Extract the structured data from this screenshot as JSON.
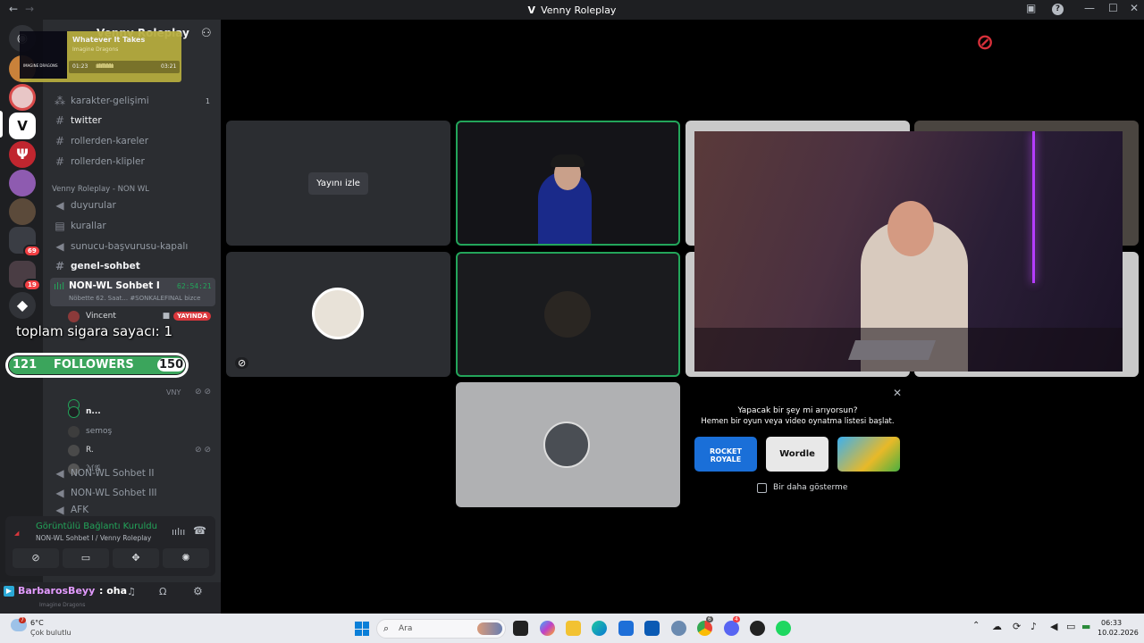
{
  "window": {
    "title": "Venny Roleplay",
    "back": "←",
    "forward": "→",
    "logo": "V"
  },
  "server_title": "Venny Roleplay",
  "music": {
    "song": "Whatever It Takes",
    "artist": "Imagine Dragons",
    "album_text": "IMAGINE DRAGONS",
    "elapsed": "01:23",
    "total": "03:21",
    "progress": 0.41
  },
  "channels_top": [
    {
      "name": "karakter-gelişimi",
      "count": "1"
    },
    {
      "name": "twitter"
    },
    {
      "name": "rollerden-kareler"
    },
    {
      "name": "rollerden-klipler"
    }
  ],
  "category": "Venny Roleplay - NON WL",
  "channels_mid": [
    {
      "name": "duyurular"
    },
    {
      "name": "kurallar"
    },
    {
      "name": "sunucu-başvurusu-kapalı"
    },
    {
      "name": "genel-sohbet"
    }
  ],
  "active_voice": {
    "name": "NON-WL Sohbet I",
    "timer": "62:54:21",
    "status": "Nöbette 62. Saat... #SONKALEFİNAL bizce"
  },
  "members": [
    {
      "name": "Vincent",
      "badge": "YAYINDA"
    },
    {
      "name": "n..."
    },
    {
      "name": "semoş"
    },
    {
      "name": "R."
    },
    {
      "name": "ℳ𝒢"
    }
  ],
  "voice_channels": [
    "NON-WL Sohbet II",
    "NON-WL Sohbet III",
    "AFK"
  ],
  "overlay": {
    "smoke_counter": "toplam sigara sayacı: 1",
    "followers_current": "121",
    "followers_label": "FOLLOWERS",
    "followers_goal": "150",
    "partial_name": "VNY"
  },
  "voice_panel": {
    "status": "Görüntülü Bağlantı Kuruldu",
    "location": "NON-WL Sohbet I / Venny Roleplay"
  },
  "user_bar": {
    "chat_name": "BarbarosBeyy",
    "chat_msg": ": oha",
    "sub": "Imagine Dragons"
  },
  "call": {
    "watch_stream": "Yayını izle"
  },
  "activity_popup": {
    "title": "Yapacak bir şey mi arıyorsun?",
    "subtitle": "Hemen bir oyun veya video oynatma listesi başlat.",
    "games": [
      {
        "name": "ROCKET ROYALE",
        "color": "#1a6fd8"
      },
      {
        "name": "Wordle",
        "color": "#e8e8e8"
      },
      {
        "name": "",
        "color": "#e8b928"
      }
    ],
    "checkbox": "Bir daha gösterme",
    "close": "✕"
  },
  "taskbar": {
    "weather_temp": "6°C",
    "weather_desc": "Çok bulutlu",
    "weather_badge": "7",
    "search": "Ara",
    "time": "06:33",
    "date": "10.02.2026",
    "discord_badge": "4",
    "chrome_badge": "6"
  },
  "colors": {
    "accent_green": "#23a55a",
    "live_red": "#da373c",
    "follower_green": "#3ba55c"
  }
}
